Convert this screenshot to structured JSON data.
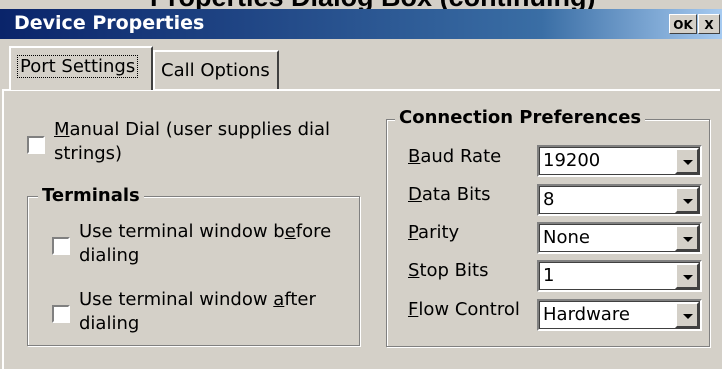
{
  "cut_title": "Properties Dialog Box (continuing)",
  "window": {
    "title": "Device Properties",
    "ok_label": "OK",
    "close_label": "X"
  },
  "tabs": [
    {
      "label": "Port Settings",
      "active": true
    },
    {
      "label": "Call Options",
      "active": false
    }
  ],
  "manual_dial": {
    "accel": "M",
    "label_rest": "anual Dial (user supplies dial",
    "label_line2": "strings)",
    "checked": false
  },
  "terminals": {
    "title": "Terminals",
    "before": {
      "pre": "Use terminal window b",
      "accel": "e",
      "post": "fore",
      "line2": "dialing",
      "checked": false
    },
    "after": {
      "pre": "Use terminal window ",
      "accel": "a",
      "post": "fter",
      "line2": "dialing",
      "checked": false
    }
  },
  "connection": {
    "title": "Connection Preferences",
    "fields": [
      {
        "accel": "B",
        "rest": "aud Rate",
        "value": "19200"
      },
      {
        "accel": "D",
        "rest": "ata Bits",
        "value": "8"
      },
      {
        "accel": "P",
        "rest": "arity",
        "value": "None"
      },
      {
        "accel": "S",
        "rest": "top Bits",
        "value": "1"
      },
      {
        "accel": "F",
        "rest": "low Control",
        "value": "Hardware"
      }
    ]
  }
}
